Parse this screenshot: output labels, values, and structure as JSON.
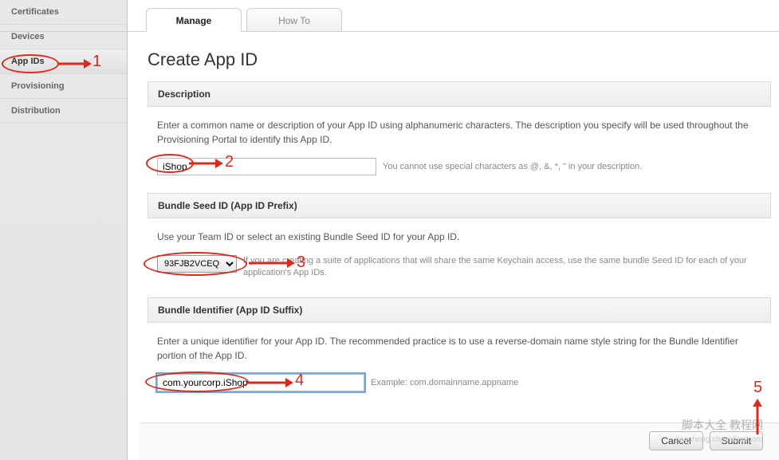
{
  "sidebar": {
    "items": [
      {
        "label": "Certificates"
      },
      {
        "label": "Devices"
      },
      {
        "label": "App IDs"
      },
      {
        "label": "Provisioning"
      },
      {
        "label": "Distribution"
      }
    ]
  },
  "tabs": {
    "manage": "Manage",
    "howto": "How To"
  },
  "page_title": "Create App ID",
  "sections": {
    "description": {
      "heading": "Description",
      "text": "Enter a common name or description of your App ID using alphanumeric characters. The description you specify will be used throughout the Provisioning Portal to identify this App ID.",
      "input_value": "iShop",
      "hint": "You cannot use special characters as @, &, *, \" in your description."
    },
    "bundle_seed": {
      "heading": "Bundle Seed ID (App ID Prefix)",
      "text": "Use your Team ID or select an existing Bundle Seed ID for your App ID.",
      "select_value": "93FJB2VCEQ",
      "hint": "If you are creating a suite of applications that will share the same Keychain access, use the same bundle Seed ID for each of your application's App IDs."
    },
    "bundle_identifier": {
      "heading": "Bundle Identifier (App ID Suffix)",
      "text": "Enter a unique identifier for your App ID. The recommended practice is to use a reverse-domain name style string for the Bundle Identifier portion of the App ID.",
      "input_value": "com.yourcorp.iShop",
      "hint": "Example: com.domainname.appname"
    }
  },
  "buttons": {
    "cancel": "Cancel",
    "submit": "Submit"
  },
  "annotations": {
    "n1": "1",
    "n2": "2",
    "n3": "3",
    "n4": "4",
    "n5": "5"
  },
  "watermark": {
    "main": "脚本大全 教程网",
    "sub": "jiaocheng.chazidian.com"
  }
}
